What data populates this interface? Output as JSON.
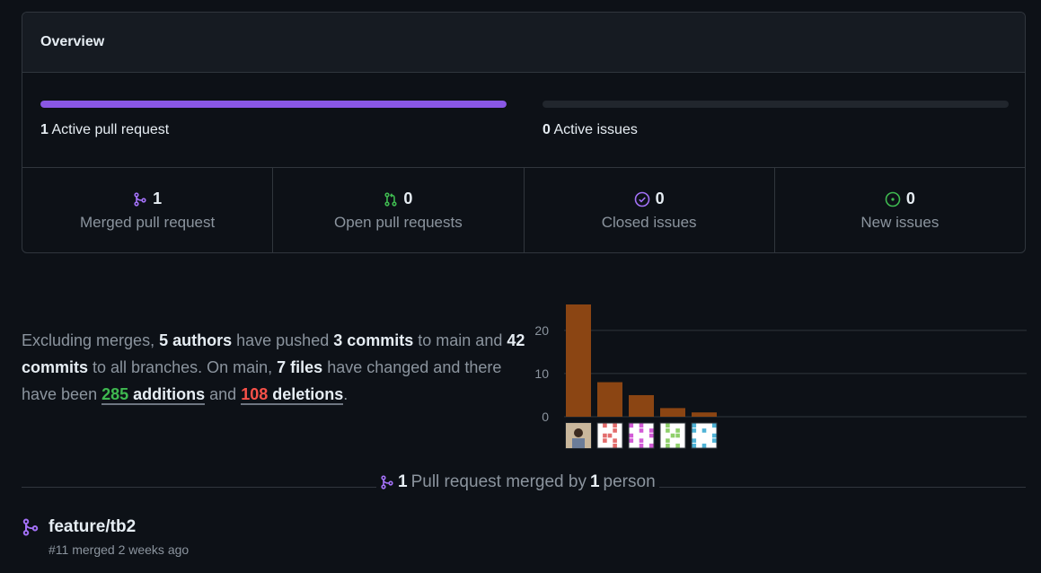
{
  "overview": {
    "title": "Overview",
    "pull_requests": {
      "count": "1",
      "label": "Active pull request",
      "fill": 1.0
    },
    "issues": {
      "count": "0",
      "label": "Active issues",
      "fill": 0.0
    },
    "stats": [
      {
        "icon": "merged-pr-icon",
        "value": "1",
        "label": "Merged pull request",
        "color": "#a371f7"
      },
      {
        "icon": "open-pr-icon",
        "value": "0",
        "label": "Open pull requests",
        "color": "#3fb950"
      },
      {
        "icon": "closed-issue-icon",
        "value": "0",
        "label": "Closed issues",
        "color": "#a371f7"
      },
      {
        "icon": "new-issue-icon",
        "value": "0",
        "label": "New issues",
        "color": "#3fb950"
      }
    ],
    "colors": {
      "purple": "#8957e5",
      "green": "#3fb950",
      "red": "#f85149"
    }
  },
  "summary": {
    "t1": "Excluding merges, ",
    "authors_count": "5",
    "authors_word": "authors",
    "t2": " have pushed ",
    "commits_main_count": "3",
    "commits_main_word": "commits",
    "t3": " to main and ",
    "commits_all_count": "42",
    "commits_all_word": "commits",
    "t4": " to all branches. On main, ",
    "files_count": "7",
    "files_word": "files",
    "t5": " have changed and there have been ",
    "additions_count": "285",
    "additions_word": "additions",
    "t6": " and ",
    "deletions_count": "108",
    "deletions_word": "deletions",
    "t7": "."
  },
  "chart_data": {
    "type": "bar",
    "categories": [
      "author-1",
      "author-2",
      "author-3",
      "author-4",
      "author-5"
    ],
    "values": [
      26,
      8,
      5,
      2,
      1
    ],
    "ylim": [
      0,
      26
    ],
    "yticks": [
      "0",
      "10",
      "20"
    ],
    "tick_values": [
      0,
      10,
      20
    ],
    "grid": true,
    "bar_color": "#8b4513",
    "avatar_colors": [
      "#c9b79c",
      "#e36d6d",
      "#d25bd6",
      "#8fd06b",
      "#4fb3d6"
    ]
  },
  "merged_section": {
    "count": "1",
    "t1": "Pull request merged by",
    "people_count": "1",
    "t2": "person"
  },
  "pr_item": {
    "title": "feature/tb2",
    "meta": "#11 merged 2 weeks ago"
  }
}
